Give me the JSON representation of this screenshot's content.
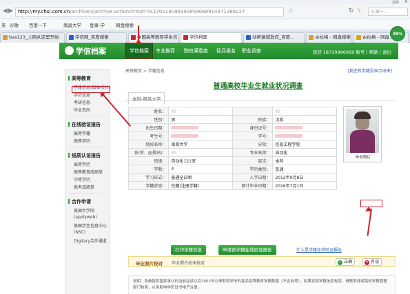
{
  "browser": {
    "window_menu": "文件",
    "url_host": "http://my.chsi.com.cn",
    "url_rest": "/archive/xjarchive.action?trnid=44270018096393959088914671389227",
    "search_placeholder": "马:索一…"
  },
  "bookmarks": [
    "谷歌",
    "百度一下",
    "南昌大学",
    "登录-学",
    "网盘搜索"
  ],
  "bookmarks_prefix": "夹",
  "tabs": [
    {
      "label": "bas123_上网从这里开始",
      "active": false,
      "fav": "#d9a02a"
    },
    {
      "label": "学信网_百度搜索",
      "active": false,
      "fav": "#2d5bd6"
    },
    {
      "label": "中国高等教育学生信...",
      "active": false,
      "fav": "#c92a2a"
    },
    {
      "label": "学信档案",
      "active": true,
      "fav": "#c92a2a"
    },
    {
      "label": "动帮遍城放应_百度…",
      "active": false,
      "fav": "#2d5bd6"
    },
    {
      "label": "古拉格 - 网盘搜索",
      "active": false,
      "fav": "#e0a020"
    },
    {
      "label": "古拉格 - 网盘...",
      "active": false,
      "fav": "#e0a020"
    }
  ],
  "gauge": "39%",
  "site": {
    "logo": "学信档案",
    "nav": [
      "学信档案",
      "专业推荐",
      "院校满意度",
      "征兵报名",
      "职业调查"
    ],
    "nav_active": 0,
    "welcome": "欢迎 18720996069 账号 | 帮助 | 退出"
  },
  "sidebar": [
    {
      "title": "高等教育",
      "items": [
        "学籍信息(图像校对)",
        "学历信息",
        "考研信息",
        "毕业去向"
      ],
      "active_item": 0
    },
    {
      "title": "在线验证报告",
      "items": [
        "高等学籍",
        "高等学历"
      ]
    },
    {
      "title": "纸质认证报告",
      "items": [
        "高等学历",
        "高等教育成绩单",
        "中等学历",
        "高考成绩单"
      ]
    },
    {
      "title": "合作申请",
      "items": [
        "美国大学网",
        "(applyweb)",
        "美国学生信息中心",
        "(NSC)",
        "Digitary合作通道"
      ]
    }
  ],
  "main": {
    "breadcrumb": "高等教育 > 学籍信息",
    "report_link": "[我还有学籍没显示出来]",
    "title": "普通高校毕业生就业状况调查",
    "panel_tab": "本科-南昌大学",
    "rows": [
      {
        "l1": "姓名：",
        "v1": "",
        "l2": "",
        "v2": ""
      },
      {
        "l1": "性别：",
        "v1": "男",
        "l2": "民族：",
        "v2": "汉族"
      },
      {
        "l1": "出生日期：",
        "v1": "",
        "l2": "身份证号：",
        "v2": ""
      },
      {
        "l1": "考生号：",
        "v1": "",
        "l2": "学号：",
        "v2": ""
      },
      {
        "l1": "院校名称：",
        "v1": "南昌大学",
        "l2": "分院：",
        "v2": "信息工程学院"
      },
      {
        "l1": "系(所、函授站)：",
        "v1": "",
        "l2": "专业名称：",
        "v2": "自动化"
      },
      {
        "l1": "班级：",
        "v1": "自动化121班",
        "l2": "层次：",
        "v2": "本科"
      },
      {
        "l1": "学制：",
        "v1": "4",
        "l2": "学历类别：",
        "v2": "普通"
      },
      {
        "l1": "学习形式：",
        "v1": "普通全日制",
        "l2": "入学日期：",
        "v2": "2012年9月8日"
      },
      {
        "l1": "学籍状态：",
        "v1": "在籍(注册学籍)",
        "l2": "预计毕业日期：",
        "v2": "2016年7月1日"
      }
    ],
    "photo_caption": "毕业照片",
    "print_button": "打印学籍信息",
    "apply_button": "申请该学籍在线验证报告",
    "verify_link": "什么是学籍在线验证报告",
    "verify_title": "毕业照片校对",
    "verify_desc": "毕业照片尚未校对",
    "correct_button": "正确",
    "error_button": "有误",
    "note": "说明：系统提供国家承认的当前在读以及2002年以来取得学历的各类高等教育学籍数据（不含自考）。如果发现学籍信息有误，请联系就读院校学籍管理部门核实，以免影响学历证书电子注册。"
  }
}
